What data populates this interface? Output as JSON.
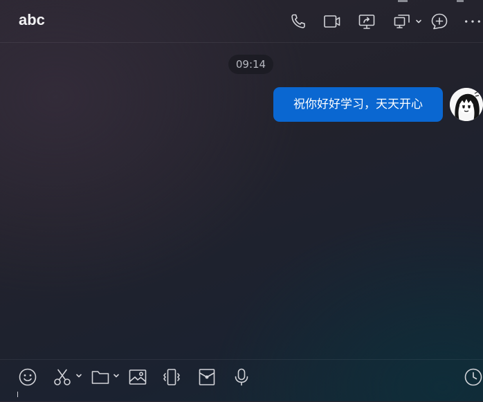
{
  "header": {
    "title": "abc",
    "icons": [
      "phone-icon",
      "video-camera-icon",
      "screen-share-icon",
      "remote-assist-icon",
      "add-member-icon",
      "more-icon"
    ]
  },
  "messages": [
    {
      "time": "09:14",
      "text": "祝你好好学习，天天开心",
      "sender": "self",
      "bubble_color": "#0a67d1"
    }
  ],
  "toolbar": {
    "icons": [
      "emoji-icon",
      "scissors-icon",
      "folder-icon",
      "image-icon",
      "vibrate-icon",
      "red-packet-icon",
      "microphone-icon",
      "history-icon"
    ]
  },
  "colors": {
    "accent": "#0a67d1",
    "background": "#22222c"
  }
}
